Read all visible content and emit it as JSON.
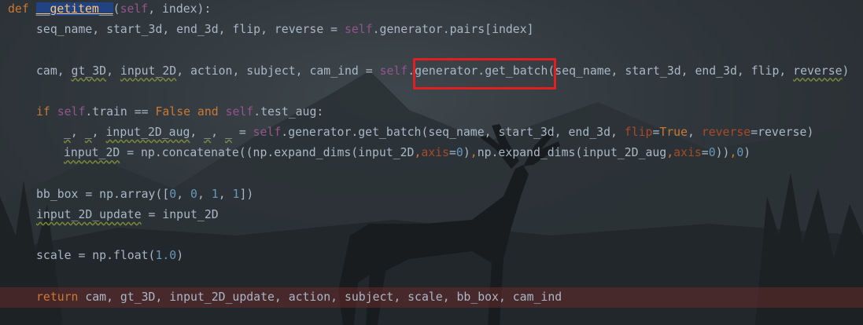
{
  "editor": {
    "lines": [
      {
        "indent": 0,
        "highlight": false,
        "tokens": [
          {
            "t": "def ",
            "c": "kw"
          },
          {
            "t": "__getitem__",
            "c": "defname"
          },
          {
            "t": "(",
            "c": "name"
          },
          {
            "t": "self",
            "c": "self"
          },
          {
            "t": ", index):",
            "c": "name"
          }
        ]
      },
      {
        "indent": 1,
        "highlight": false,
        "tokens": [
          {
            "t": "seq_name, start_3d, end_3d, flip, reverse = ",
            "c": "name"
          },
          {
            "t": "self",
            "c": "self"
          },
          {
            "t": ".generator.pairs[index]",
            "c": "name"
          }
        ]
      },
      {
        "indent": 0,
        "highlight": false,
        "tokens": []
      },
      {
        "indent": 1,
        "highlight": false,
        "tokens": [
          {
            "t": "cam, ",
            "c": "name"
          },
          {
            "t": "gt_3D",
            "c": "name warn"
          },
          {
            "t": ", ",
            "c": "name"
          },
          {
            "t": "input_2D",
            "c": "name warn"
          },
          {
            "t": ", action, subject, cam_ind = ",
            "c": "name"
          },
          {
            "t": "self",
            "c": "self"
          },
          {
            "t": ".generator.get_batch(seq_name, start_3d, end_3d, flip, ",
            "c": "name"
          },
          {
            "t": "reverse",
            "c": "name warn"
          },
          {
            "t": ")",
            "c": "name"
          }
        ]
      },
      {
        "indent": 0,
        "highlight": false,
        "tokens": []
      },
      {
        "indent": 1,
        "highlight": false,
        "tokens": [
          {
            "t": "if ",
            "c": "kw"
          },
          {
            "t": "self",
            "c": "self"
          },
          {
            "t": ".train == ",
            "c": "name"
          },
          {
            "t": "False ",
            "c": "kw"
          },
          {
            "t": "and ",
            "c": "kw"
          },
          {
            "t": "self",
            "c": "self"
          },
          {
            "t": ".test_aug:",
            "c": "name"
          }
        ]
      },
      {
        "indent": 2,
        "highlight": false,
        "tokens": [
          {
            "t": "_",
            "c": "name warn"
          },
          {
            "t": ", ",
            "c": "name"
          },
          {
            "t": "_",
            "c": "name warn"
          },
          {
            "t": ", ",
            "c": "name"
          },
          {
            "t": "input_2D_aug",
            "c": "name warn"
          },
          {
            "t": ", ",
            "c": "name"
          },
          {
            "t": "_",
            "c": "name warn"
          },
          {
            "t": ", ",
            "c": "name"
          },
          {
            "t": "_",
            "c": "name warn"
          },
          {
            "t": " = ",
            "c": "name"
          },
          {
            "t": "self",
            "c": "self"
          },
          {
            "t": ".generator.get_batch(seq_name, start_3d, end_3d, ",
            "c": "name"
          },
          {
            "t": "flip",
            "c": "param"
          },
          {
            "t": "=",
            "c": "name"
          },
          {
            "t": "True",
            "c": "kw"
          },
          {
            "t": ", ",
            "c": "name"
          },
          {
            "t": "reverse",
            "c": "param"
          },
          {
            "t": "=reverse)",
            "c": "name"
          }
        ]
      },
      {
        "indent": 2,
        "highlight": false,
        "tokens": [
          {
            "t": "input_2D",
            "c": "name warn"
          },
          {
            "t": " = np.concatenate((np.expand_dims(input_2D",
            "c": "name"
          },
          {
            "t": ",",
            "c": "kw"
          },
          {
            "t": "axis",
            "c": "param"
          },
          {
            "t": "=",
            "c": "name"
          },
          {
            "t": "0",
            "c": "num"
          },
          {
            "t": ")",
            "c": "name"
          },
          {
            "t": ",",
            "c": "kw"
          },
          {
            "t": "np.expand_dims(input_2D_aug",
            "c": "name"
          },
          {
            "t": ",",
            "c": "kw"
          },
          {
            "t": "axis",
            "c": "param"
          },
          {
            "t": "=",
            "c": "name"
          },
          {
            "t": "0",
            "c": "num"
          },
          {
            "t": "))",
            "c": "name"
          },
          {
            "t": ",",
            "c": "kw"
          },
          {
            "t": "0",
            "c": "num"
          },
          {
            "t": ")",
            "c": "name"
          }
        ]
      },
      {
        "indent": 0,
        "highlight": false,
        "tokens": []
      },
      {
        "indent": 1,
        "highlight": false,
        "tokens": [
          {
            "t": "bb_box = np.array([",
            "c": "name"
          },
          {
            "t": "0",
            "c": "num"
          },
          {
            "t": ", ",
            "c": "name"
          },
          {
            "t": "0",
            "c": "num"
          },
          {
            "t": ", ",
            "c": "name"
          },
          {
            "t": "1",
            "c": "num"
          },
          {
            "t": ", ",
            "c": "name"
          },
          {
            "t": "1",
            "c": "num"
          },
          {
            "t": "])",
            "c": "name"
          }
        ]
      },
      {
        "indent": 1,
        "highlight": false,
        "tokens": [
          {
            "t": "input_2D_update",
            "c": "name warn"
          },
          {
            "t": " = input_2D",
            "c": "name"
          }
        ]
      },
      {
        "indent": 0,
        "highlight": false,
        "tokens": []
      },
      {
        "indent": 1,
        "highlight": false,
        "tokens": [
          {
            "t": "scale = np.float(",
            "c": "name"
          },
          {
            "t": "1.0",
            "c": "num"
          },
          {
            "t": ")",
            "c": "name"
          }
        ]
      },
      {
        "indent": 0,
        "highlight": false,
        "tokens": []
      },
      {
        "indent": 1,
        "highlight": true,
        "tokens": [
          {
            "t": "return ",
            "c": "kw"
          },
          {
            "t": "cam, gt_3D, input_2D_update, action, subject, scale, bb_box, cam_ind",
            "c": "name"
          }
        ]
      }
    ]
  },
  "annotation": {
    "color": "#e02020"
  },
  "colors": {
    "background": "#2b2f33",
    "keyword": "#cc7832",
    "self": "#94558d",
    "number": "#6897bb",
    "param": "#aa4926",
    "function": "#ffc66d",
    "text": "#a9b7c6",
    "highlight_line": "#5a2e2e"
  }
}
